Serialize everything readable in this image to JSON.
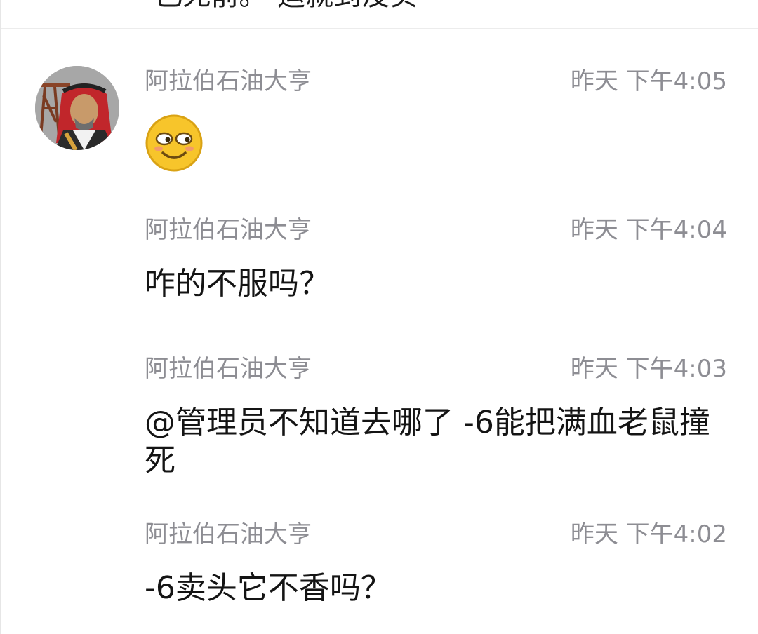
{
  "previous_message": {
    "text": "-已死前。-运就到没实"
  },
  "messages": [
    {
      "sender": "阿拉伯石油大亨",
      "time": "昨天 下午4:05",
      "type": "emoji",
      "emoji_icon": "smiling-face-emoji-icon"
    },
    {
      "sender": "阿拉伯石油大亨",
      "time": "昨天 下午4:04",
      "type": "text",
      "text": "咋的不服吗？"
    },
    {
      "sender": "阿拉伯石油大亨",
      "time": "昨天 下午4:03",
      "type": "text",
      "text": "@管理员不知道去哪了 -6能把满血老鼠撞死"
    },
    {
      "sender": "阿拉伯石油大亨",
      "time": "昨天 下午4:02",
      "type": "text",
      "text": "-6卖头它不香吗？"
    }
  ],
  "colors": {
    "meta_text": "#8d8d93",
    "body_text": "#141414",
    "divider": "#ececec",
    "emoji_fill": "#f7c52b"
  }
}
